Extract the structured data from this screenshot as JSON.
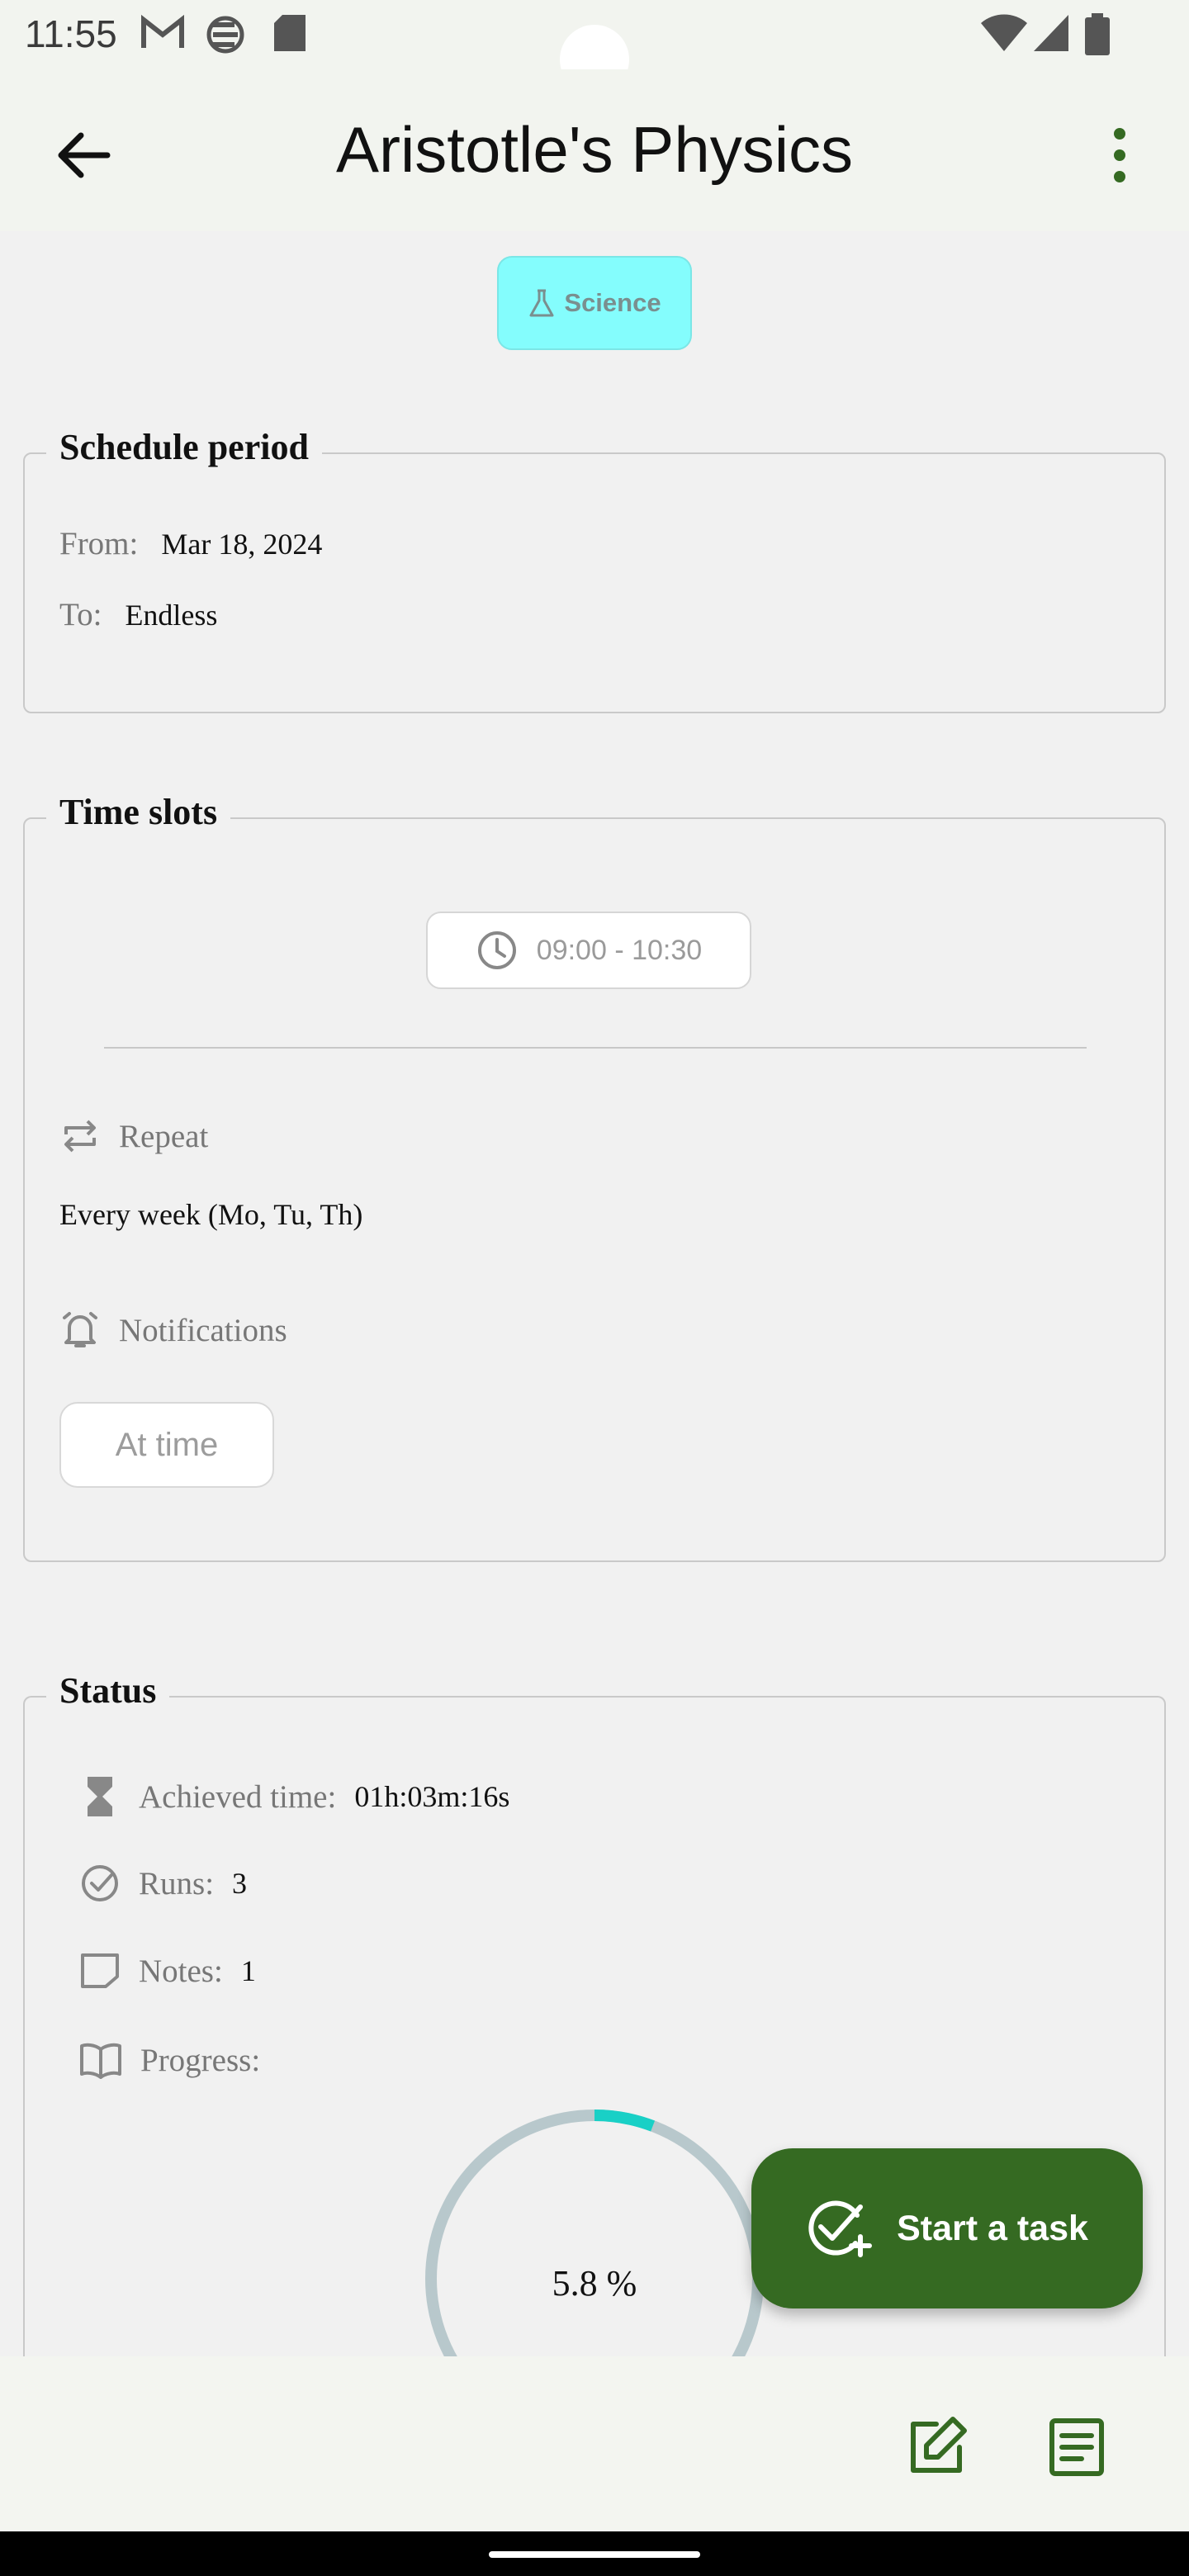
{
  "status_bar": {
    "time": "11:55",
    "icons": [
      "gmail-icon",
      "sync-icon",
      "sd-card-icon",
      "wifi-icon",
      "signal-icon",
      "battery-icon"
    ]
  },
  "app_bar": {
    "title": "Aristotle's Physics",
    "back_icon": "arrow-back-icon",
    "menu_icon": "more-vert-icon"
  },
  "category_chip": {
    "icon": "flask-icon",
    "label": "Science",
    "color": "#84fdfd"
  },
  "schedule_period": {
    "legend": "Schedule period",
    "from_label": "From:",
    "from_value": "Mar 18, 2024",
    "to_label": "To:",
    "to_value": "Endless"
  },
  "time_slots": {
    "legend": "Time slots",
    "slot": "09:00 - 10:30",
    "repeat_label": "Repeat",
    "repeat_value": "Every  week (Mo, Tu, Th)",
    "notifications_label": "Notifications",
    "notification_chip": "At time"
  },
  "status": {
    "legend": "Status",
    "achieved_label": "Achieved time:",
    "achieved_value": "01h:03m:16s",
    "runs_label": "Runs:",
    "runs_value": "3",
    "notes_label": "Notes:",
    "notes_value": "1",
    "progress_label": "Progress:",
    "progress_percent": 5.8,
    "progress_text": "5.8 %"
  },
  "fab": {
    "label": "Start a task",
    "icon": "task-add-icon",
    "color": "#356a22"
  },
  "bottom_bar": {
    "edit_icon": "edit-icon",
    "notes_icon": "notes-icon"
  },
  "colors": {
    "accent": "#356a22",
    "progress": "#19d0c6",
    "track": "#b8c8cc"
  }
}
